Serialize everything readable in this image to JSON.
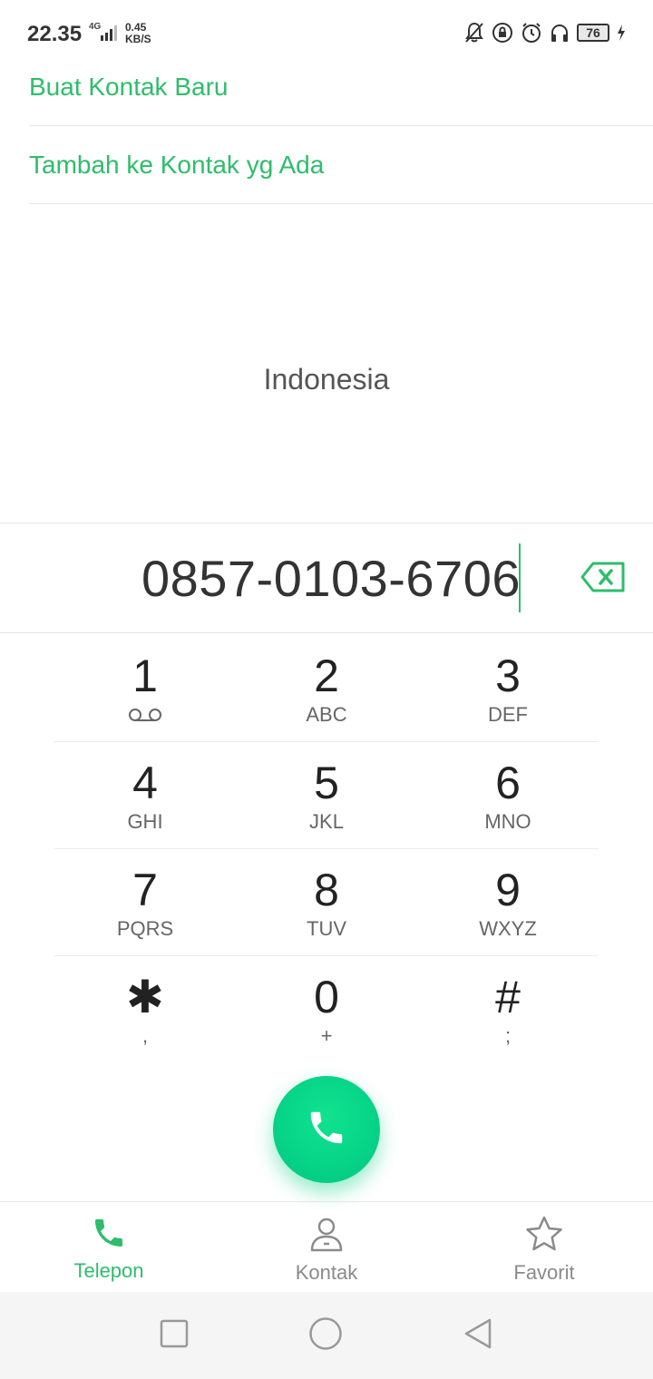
{
  "status_bar": {
    "time": "22.35",
    "network": "4G",
    "speed_value": "0.45",
    "speed_unit": "KB/S",
    "battery": "76",
    "icons": [
      "bell-off-icon",
      "lock-rotation-icon",
      "alarm-icon",
      "headphones-icon",
      "battery-icon",
      "charging-icon"
    ]
  },
  "options": {
    "create_contact": "Buat Kontak Baru",
    "add_to_existing": "Tambah ke Kontak yg Ada"
  },
  "region": "Indonesia",
  "dial": {
    "number": "0857-0103-6706"
  },
  "keypad": [
    [
      {
        "digit": "1",
        "sub": ""
      },
      {
        "digit": "2",
        "sub": "ABC"
      },
      {
        "digit": "3",
        "sub": "DEF"
      }
    ],
    [
      {
        "digit": "4",
        "sub": "GHI"
      },
      {
        "digit": "5",
        "sub": "JKL"
      },
      {
        "digit": "6",
        "sub": "MNO"
      }
    ],
    [
      {
        "digit": "7",
        "sub": "PQRS"
      },
      {
        "digit": "8",
        "sub": "TUV"
      },
      {
        "digit": "9",
        "sub": "WXYZ"
      }
    ],
    [
      {
        "digit": "✱",
        "sub": ","
      },
      {
        "digit": "0",
        "sub": "+"
      },
      {
        "digit": "#",
        "sub": ";"
      }
    ]
  ],
  "tabs": {
    "phone": "Telepon",
    "contacts": "Kontak",
    "favorites": "Favorit"
  },
  "colors": {
    "accent": "#2ebd6b",
    "call_button": "#06d488"
  }
}
